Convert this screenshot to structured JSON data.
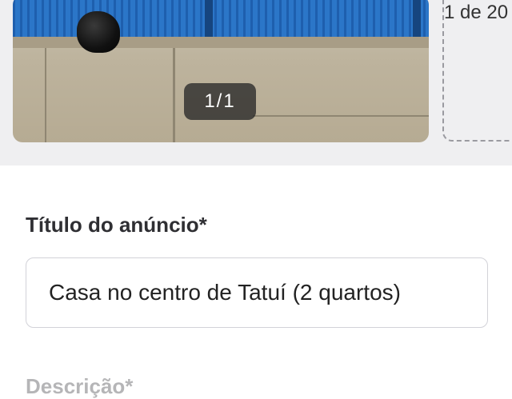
{
  "photo": {
    "counter": "1/1",
    "upload_count": "1 de 20"
  },
  "title_field": {
    "label": "Título do anúncio*",
    "value": "Casa no centro de Tatuí (2 quartos)"
  },
  "next_field": {
    "label": "Descrição*"
  },
  "colors": {
    "band_background": "#efeff1",
    "fence_blue": "#2b76c8",
    "input_border": "#d2d2d8"
  }
}
